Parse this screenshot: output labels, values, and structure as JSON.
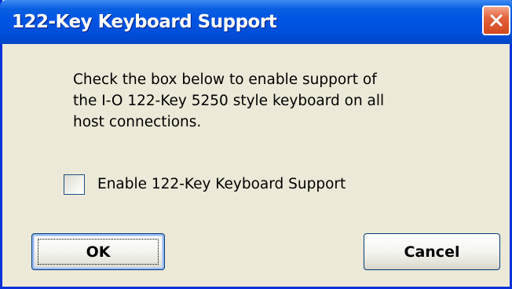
{
  "dialog": {
    "title": "122-Key Keyboard Support",
    "close_icon": "close-icon",
    "message_lines": [
      "Check the box below to enable support of",
      "the I-O 122-Key 5250 style keyboard on all",
      "host connections."
    ],
    "checkbox": {
      "label": "Enable 122-Key Keyboard Support",
      "checked": false
    },
    "buttons": {
      "ok_label": "OK",
      "cancel_label": "Cancel"
    }
  },
  "colors": {
    "title_bar": "#0054e3",
    "window_border": "#0831d9",
    "dialog_background": "#ece9d8",
    "close_button": "#d2481e",
    "button_border": "#003c74"
  }
}
